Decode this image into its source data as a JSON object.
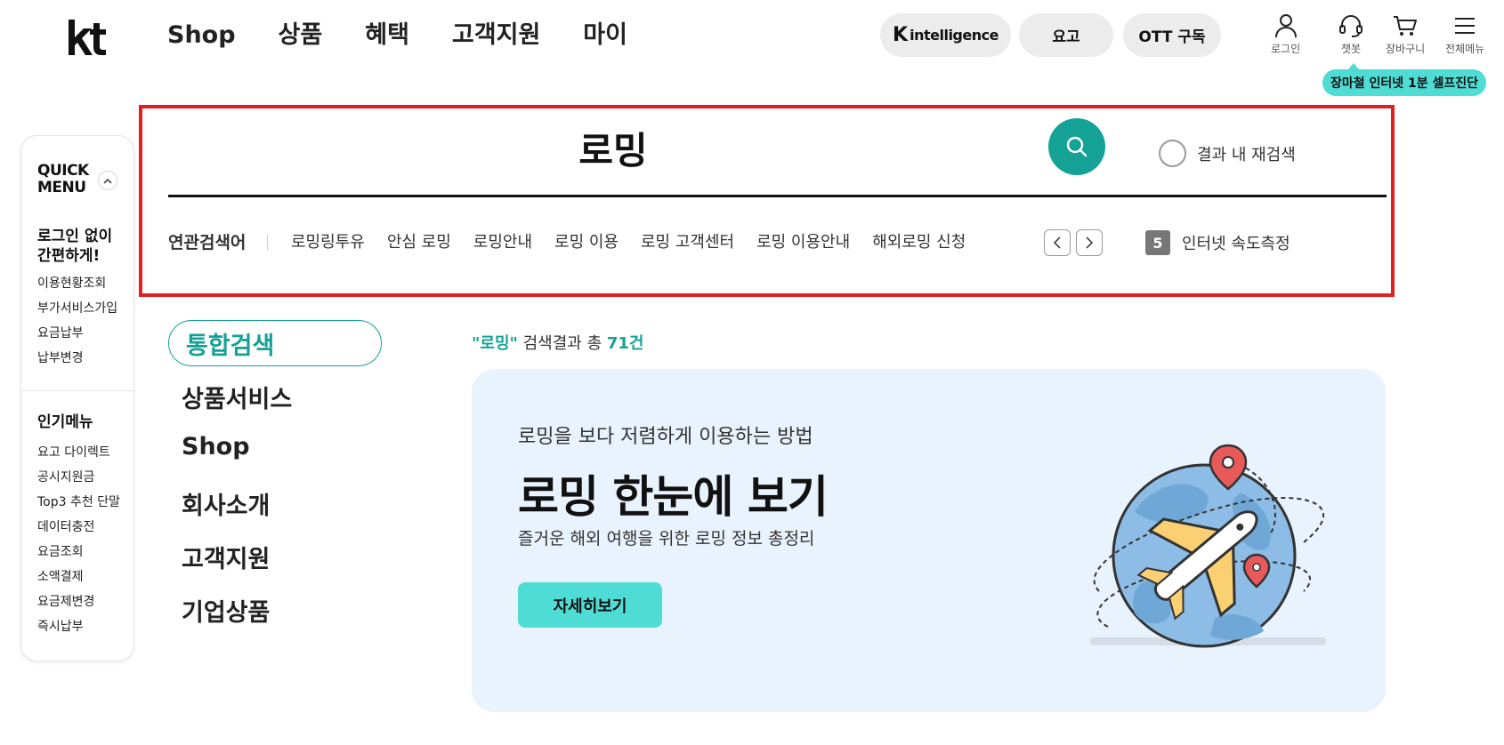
{
  "header": {
    "logo_text": "kt",
    "nav": [
      "Shop",
      "상품",
      "혜택",
      "고객지원",
      "마이"
    ],
    "pill_k_mark": "K",
    "pill_k_text": "intelligence",
    "pill_yogo": "요고",
    "pill_ott": "OTT 구독",
    "util": {
      "login": "로그인",
      "chatbot": "챗봇",
      "cart": "장바구니",
      "all_menu": "전체메뉴"
    },
    "tooltip": "장마철 인터넷 1분 셀프진단"
  },
  "quick_menu": {
    "title_line1": "QUICK",
    "title_line2": "MENU",
    "toggle": "^",
    "section1_title_line1": "로그인 없이",
    "section1_title_line2": "간편하게!",
    "section1_items": [
      "이용현황조회",
      "부가서비스가입",
      "요금납부",
      "납부변경"
    ],
    "section2_title": "인기메뉴",
    "section2_items": [
      "요고 다이렉트",
      "공시지원금",
      "Top3 추천 단말",
      "데이터충전",
      "요금조회",
      "소액결제",
      "요금제변경",
      "즉시납부"
    ]
  },
  "search": {
    "query": "로밍",
    "research_label": "결과 내 재검색",
    "related_title": "연관검색어",
    "related_terms": [
      "로밍링투유",
      "안심 로밍",
      "로밍안내",
      "로밍 이용",
      "로밍 고객센터",
      "로밍 이용안내",
      "해외로밍 신청"
    ],
    "rank_number": "5",
    "rank_text": "인터넷 속도측정"
  },
  "categories": {
    "active": "통합검색",
    "items": [
      "상품서비스",
      "Shop",
      "회사소개",
      "고객지원",
      "기업상품"
    ]
  },
  "results": {
    "keyword": "\"로밍\"",
    "count_prefix": " 검색결과 총 ",
    "count": "71건"
  },
  "banner": {
    "subtitle": "로밍을 보다 저렴하게 이용하는 방법",
    "title": "로밍 한눈에 보기",
    "description": "즐거운 해외 여행을 위한 로밍 정보 총정리",
    "button": "자세히보기"
  },
  "colors": {
    "accent": "#14a196",
    "mint": "#4fdcd4",
    "highlight_frame": "#e02020",
    "banner_bg": "#e9f3fd"
  }
}
